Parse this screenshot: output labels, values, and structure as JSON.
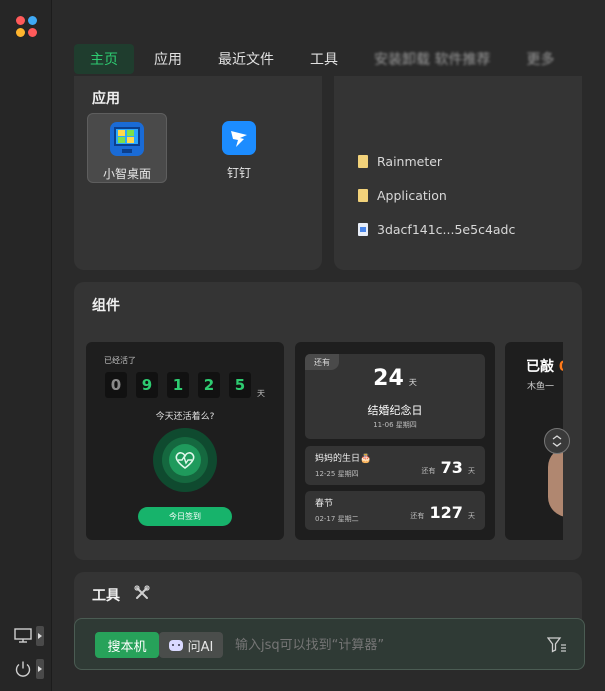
{
  "tabs": [
    {
      "label": "主页",
      "active": true
    },
    {
      "label": "应用"
    },
    {
      "label": "最近文件"
    },
    {
      "label": "工具"
    },
    {
      "label": "安装卸载 软件推荐"
    },
    {
      "label": "更多"
    }
  ],
  "apps_panel": {
    "title": "应用",
    "apps": [
      {
        "label": "小智桌面",
        "icon": "desktop-app-icon"
      },
      {
        "label": "钉钉",
        "icon": "dingtalk-icon"
      }
    ]
  },
  "recent_files": [
    {
      "name": "Rainmeter",
      "icon": "file-icon"
    },
    {
      "name": "Application",
      "icon": "file-icon"
    },
    {
      "name": "3dacf141c...5e5c4adc",
      "icon": "doc-file-icon"
    }
  ],
  "widgets_panel": {
    "title": "组件",
    "alive": {
      "label": "已经活了",
      "digits": [
        "0",
        "9",
        "1",
        "2",
        "5"
      ],
      "unit": "天",
      "question": "今天还活着么?",
      "checkin": "今日签到"
    },
    "anniversary": {
      "tag": "还有",
      "days": "24",
      "unit": "天",
      "title": "结婚纪念日",
      "date": "11-06 星期四",
      "events": [
        {
          "name": "妈妈的生日🎂",
          "date": "12-25 星期四",
          "prefix": "还有",
          "days": "73",
          "unit": "天"
        },
        {
          "name": "春节",
          "date": "02-17 星期二",
          "prefix": "还有",
          "days": "127",
          "unit": "天"
        }
      ]
    },
    "wooden_fish": {
      "title": "已敲",
      "subtitle": "木鱼一"
    }
  },
  "tools_panel": {
    "title": "工具"
  },
  "search": {
    "mode_search": "搜本机",
    "mode_ai": "问AI",
    "placeholder": "输入jsq可以找到“计算器”"
  },
  "colors": {
    "accent": "#2ecc71",
    "panel": "#343434",
    "background": "#2a2a2a"
  }
}
